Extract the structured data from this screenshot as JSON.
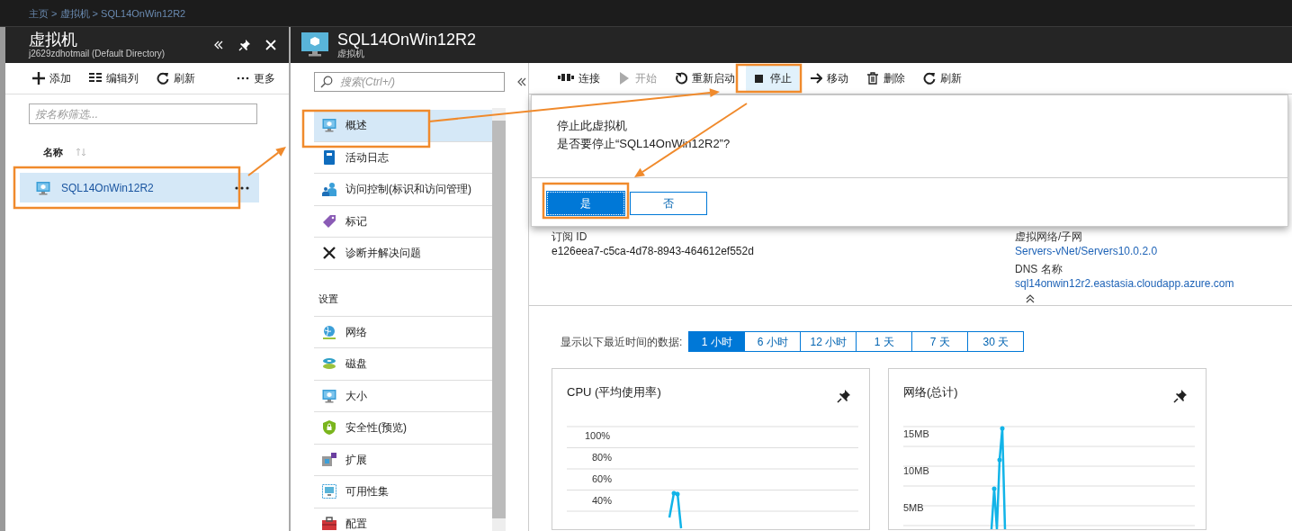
{
  "breadcrumb": "主页 > 虚拟机 > SQL14OnWin12R2",
  "list_blade": {
    "title": "虚拟机",
    "subtitle": "j2629zdhotmail (Default Directory)",
    "toolbar": [
      {
        "label": "添加"
      },
      {
        "label": "编辑列"
      },
      {
        "label": "刷新"
      },
      {
        "label": "更多"
      }
    ],
    "filter": {
      "placeholder": "按名称筛选..."
    },
    "column": "名称",
    "rows": [
      {
        "name": "SQL14OnWin12R2",
        "selected": true
      }
    ]
  },
  "vm_blade": {
    "title": "SQL14OnWin12R2",
    "subtitle": "虚拟机",
    "search": {
      "placeholder": "搜索(Ctrl+/)"
    },
    "menu": [
      {
        "kind": "item",
        "label": "概述",
        "selected": true
      },
      {
        "kind": "item",
        "label": "活动日志",
        "selected": false
      },
      {
        "kind": "item",
        "label": "访问控制(标识和访问管理)",
        "selected": false
      },
      {
        "kind": "item",
        "label": "标记",
        "selected": false
      },
      {
        "kind": "item",
        "label": "诊断并解决问题",
        "selected": false
      },
      {
        "kind": "header",
        "label": "设置"
      },
      {
        "kind": "item",
        "label": "网络",
        "selected": false
      },
      {
        "kind": "item",
        "label": "磁盘",
        "selected": false
      },
      {
        "kind": "item",
        "label": "大小",
        "selected": false
      },
      {
        "kind": "item",
        "label": "安全性(预览)",
        "selected": false
      },
      {
        "kind": "item",
        "label": "扩展",
        "selected": false
      },
      {
        "kind": "item",
        "label": "可用性集",
        "selected": false
      },
      {
        "kind": "item",
        "label": "配置",
        "selected": false
      }
    ],
    "toolbar": [
      {
        "label": "连接",
        "disabled": false,
        "selected": false
      },
      {
        "label": "开始",
        "disabled": true,
        "selected": false
      },
      {
        "label": "重新启动",
        "disabled": false,
        "selected": false
      },
      {
        "label": "停止",
        "disabled": false,
        "selected": true
      },
      {
        "label": "移动",
        "disabled": false,
        "selected": false
      },
      {
        "label": "删除",
        "disabled": false,
        "selected": false
      },
      {
        "label": "刷新",
        "disabled": false,
        "selected": false
      }
    ],
    "dialog": {
      "title": "停止此虚拟机",
      "message": "是否要停止“SQL14OnWin12R2”?",
      "buttons": [
        {
          "label": "是",
          "primary": true
        },
        {
          "label": "否",
          "primary": false
        }
      ]
    },
    "overview": {
      "left": [
        {
          "label": "订阅 ID",
          "value": "e126eea7-c5ca-4d78-8943-464612ef552d",
          "link": false
        }
      ],
      "right": [
        {
          "label": "虚拟网络/子网",
          "value": "Servers-vNet/Servers10.0.2.0",
          "link": true
        },
        {
          "label": "DNS 名称",
          "value": "sql14onwin12r2.eastasia.cloudapp.azure.com",
          "link": true
        }
      ]
    },
    "time_range": {
      "label": "显示以下最近时间的数据:",
      "options": [
        {
          "label": "1 小时",
          "selected": true
        },
        {
          "label": "6 小时",
          "selected": false
        },
        {
          "label": "12 小时",
          "selected": false
        },
        {
          "label": "1 天",
          "selected": false
        },
        {
          "label": "7 天",
          "selected": false
        },
        {
          "label": "30 天",
          "selected": false
        }
      ]
    },
    "charts": [
      {
        "title": "CPU (平均使用率)",
        "y_labels": [
          "100%",
          "80%",
          "60%",
          "40%"
        ]
      },
      {
        "title": "网络(总计)",
        "y_labels": [
          "15MB",
          "10MB",
          "5MB"
        ]
      }
    ]
  }
}
